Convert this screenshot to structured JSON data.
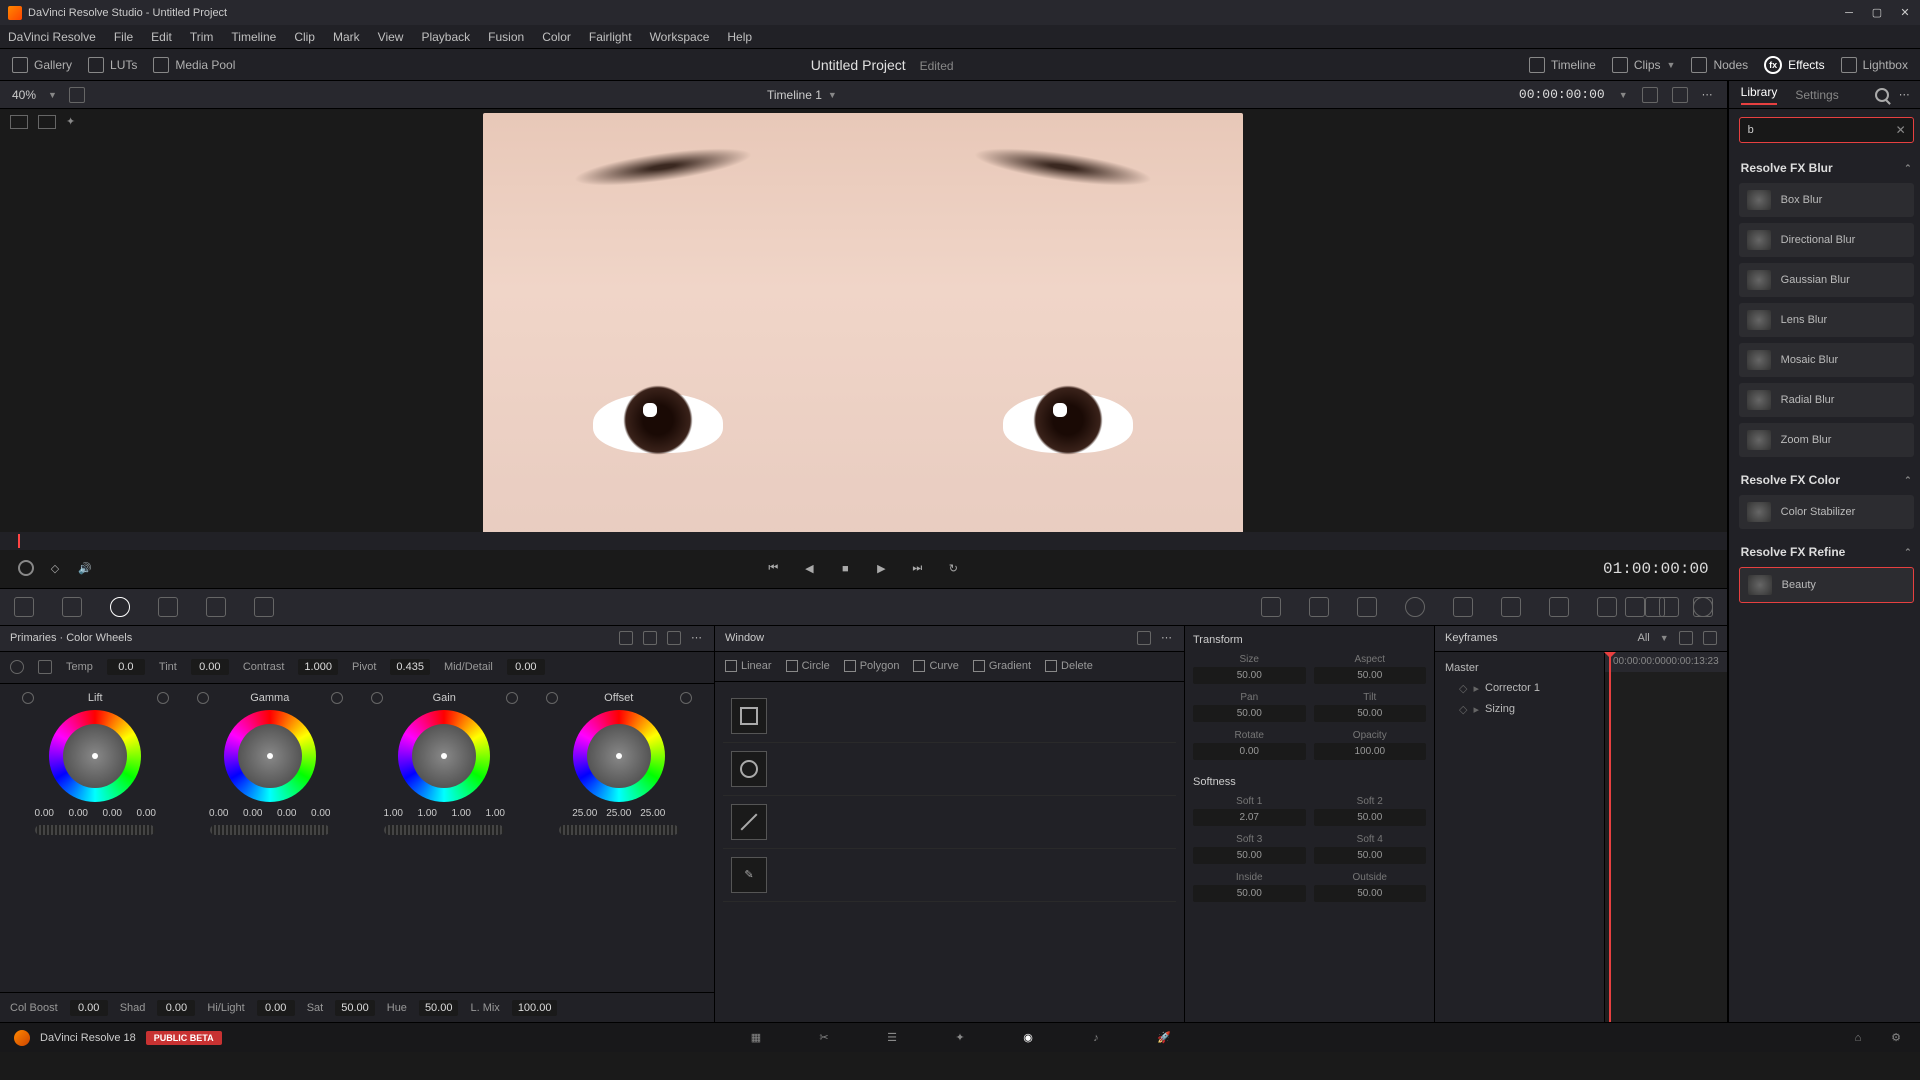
{
  "titlebar": {
    "title": "DaVinci Resolve Studio - Untitled Project"
  },
  "menubar": [
    "DaVinci Resolve",
    "File",
    "Edit",
    "Trim",
    "Timeline",
    "Clip",
    "Mark",
    "View",
    "Playback",
    "Fusion",
    "Color",
    "Fairlight",
    "Workspace",
    "Help"
  ],
  "toolbar": {
    "left": [
      {
        "label": "Gallery"
      },
      {
        "label": "LUTs"
      },
      {
        "label": "Media Pool"
      }
    ],
    "center": {
      "project": "Untitled Project",
      "status": "Edited"
    },
    "right": [
      {
        "label": "Timeline"
      },
      {
        "label": "Clips"
      },
      {
        "label": "Nodes"
      },
      {
        "label": "Effects"
      },
      {
        "label": "Lightbox"
      }
    ]
  },
  "subheader": {
    "zoom": "40%",
    "timeline": "Timeline 1",
    "timecode": "00:00:00:00"
  },
  "transport": {
    "timecode": "01:00:00:00"
  },
  "effects": {
    "tabs": {
      "library": "Library",
      "settings": "Settings"
    },
    "search_value": "b",
    "categories": [
      {
        "name": "Resolve FX Blur",
        "items": [
          "Box Blur",
          "Directional Blur",
          "Gaussian Blur",
          "Lens Blur",
          "Mosaic Blur",
          "Radial Blur",
          "Zoom Blur"
        ]
      },
      {
        "name": "Resolve FX Color",
        "items": [
          "Color Stabilizer"
        ]
      },
      {
        "name": "Resolve FX Refine",
        "items": [
          "Beauty"
        ],
        "selected": 0
      }
    ]
  },
  "primaries": {
    "title": "Primaries · Color Wheels",
    "top_adj": [
      {
        "label": "Temp",
        "val": "0.0"
      },
      {
        "label": "Tint",
        "val": "0.00"
      },
      {
        "label": "Contrast",
        "val": "1.000"
      },
      {
        "label": "Pivot",
        "val": "0.435"
      },
      {
        "label": "Mid/Detail",
        "val": "0.00"
      }
    ],
    "wheels": [
      {
        "name": "Lift",
        "nums": [
          "0.00",
          "0.00",
          "0.00",
          "0.00"
        ]
      },
      {
        "name": "Gamma",
        "nums": [
          "0.00",
          "0.00",
          "0.00",
          "0.00"
        ]
      },
      {
        "name": "Gain",
        "nums": [
          "1.00",
          "1.00",
          "1.00",
          "1.00"
        ]
      },
      {
        "name": "Offset",
        "nums": [
          "25.00",
          "25.00",
          "25.00"
        ]
      }
    ],
    "bottom_adj": [
      {
        "label": "Col Boost",
        "val": "0.00"
      },
      {
        "label": "Shad",
        "val": "0.00"
      },
      {
        "label": "Hi/Light",
        "val": "0.00"
      },
      {
        "label": "Sat",
        "val": "50.00"
      },
      {
        "label": "Hue",
        "val": "50.00"
      },
      {
        "label": "L. Mix",
        "val": "100.00"
      }
    ]
  },
  "window": {
    "title": "Window",
    "tools": [
      "Linear",
      "Circle",
      "Polygon",
      "Curve",
      "Gradient",
      "Delete"
    ]
  },
  "transform": {
    "title": "Transform",
    "fields": [
      [
        {
          "l": "Size",
          "v": "50.00"
        },
        {
          "l": "Aspect",
          "v": "50.00"
        }
      ],
      [
        {
          "l": "Pan",
          "v": "50.00"
        },
        {
          "l": "Tilt",
          "v": "50.00"
        }
      ],
      [
        {
          "l": "Rotate",
          "v": "0.00"
        },
        {
          "l": "Opacity",
          "v": "100.00"
        }
      ]
    ],
    "soft_title": "Softness",
    "soft": [
      [
        {
          "l": "Soft 1",
          "v": "2.07"
        },
        {
          "l": "Soft 2",
          "v": "50.00"
        }
      ],
      [
        {
          "l": "Soft 3",
          "v": "50.00"
        },
        {
          "l": "Soft 4",
          "v": "50.00"
        }
      ],
      [
        {
          "l": "Inside",
          "v": "50.00"
        },
        {
          "l": "Outside",
          "v": "50.00"
        }
      ]
    ]
  },
  "keyframes": {
    "title": "Keyframes",
    "all": "All",
    "tc_start": "00:00:00:00",
    "tc_end": "00:00:13:23",
    "tree": [
      "Master",
      "Corrector 1",
      "Sizing"
    ]
  },
  "bottombar": {
    "app": "DaVinci Resolve 18",
    "badge": "PUBLIC BETA"
  }
}
